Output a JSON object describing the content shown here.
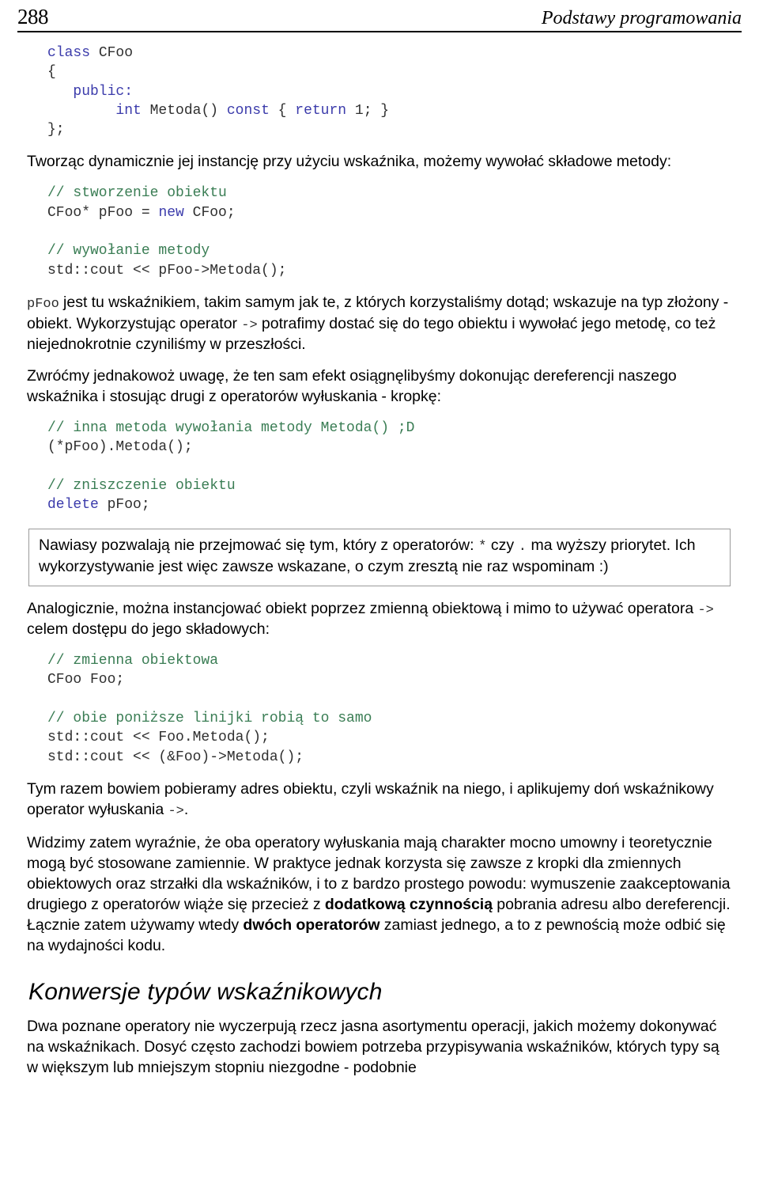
{
  "header": {
    "page_number": "288",
    "title": "Podstawy programowania"
  },
  "code_blocks": {
    "class_decl": [
      [
        {
          "t": "class",
          "c": "kw"
        },
        {
          "t": " CFoo",
          "c": "id"
        }
      ],
      [
        {
          "t": "{",
          "c": "id"
        }
      ],
      [
        {
          "t": "   ",
          "c": "id"
        },
        {
          "t": "public:",
          "c": "kw"
        }
      ],
      [
        {
          "t": "        ",
          "c": "id"
        },
        {
          "t": "int",
          "c": "kw"
        },
        {
          "t": " Metoda() ",
          "c": "id"
        },
        {
          "t": "const",
          "c": "kw"
        },
        {
          "t": " { ",
          "c": "id"
        },
        {
          "t": "return",
          "c": "kw"
        },
        {
          "t": " 1; }",
          "c": "id"
        }
      ],
      [
        {
          "t": "};",
          "c": "id"
        }
      ]
    ],
    "create_and_call": [
      [
        {
          "t": "// stworzenie obiektu",
          "c": "cm"
        }
      ],
      [
        {
          "t": "CFoo* pFoo = ",
          "c": "id"
        },
        {
          "t": "new",
          "c": "kw"
        },
        {
          "t": " CFoo;",
          "c": "id"
        }
      ],
      [
        {
          "t": "",
          "c": "id"
        }
      ],
      [
        {
          "t": "// wywołanie metody",
          "c": "cm"
        }
      ],
      [
        {
          "t": "std::cout << pFoo->Metoda();",
          "c": "id"
        }
      ]
    ],
    "deref_and_delete": [
      [
        {
          "t": "// inna metoda wywołania metody Metoda() ;D",
          "c": "cm"
        }
      ],
      [
        {
          "t": "(*pFoo).Metoda();",
          "c": "id"
        }
      ],
      [
        {
          "t": "",
          "c": "id"
        }
      ],
      [
        {
          "t": "// zniszczenie obiektu",
          "c": "cm"
        }
      ],
      [
        {
          "t": "delete",
          "c": "kw"
        },
        {
          "t": " pFoo;",
          "c": "id"
        }
      ]
    ],
    "object_variable": [
      [
        {
          "t": "// zmienna obiektowa",
          "c": "cm"
        }
      ],
      [
        {
          "t": "CFoo Foo;",
          "c": "id"
        }
      ],
      [
        {
          "t": "",
          "c": "id"
        }
      ],
      [
        {
          "t": "// obie poniższe linijki robią to samo",
          "c": "cm"
        }
      ],
      [
        {
          "t": "std::cout << Foo.Metoda();",
          "c": "id"
        }
      ],
      [
        {
          "t": "std::cout << (&Foo)->Metoda();",
          "c": "id"
        }
      ]
    ]
  },
  "paragraphs": {
    "after_class": "Tworząc dynamicznie jej instancję przy użyciu wskaźnika, możemy wywołać składowe metody:",
    "pfoo_explain_pre": "pFoo",
    "pfoo_explain_mid": " jest tu wskaźnikiem, takim samym jak te, z których korzystaliśmy dotąd; wskazuje na typ złożony - obiekt. Wykorzystując operator ",
    "pfoo_explain_arrow": "->",
    "pfoo_explain_post": " potrafimy dostać się do tego obiektu i wywołać jego metodę, co też niejednokrotnie czyniliśmy w przeszłości.",
    "dereference_note": "Zwróćmy jednakowoż uwagę, że ten sam efekt osiągnęlibyśmy dokonując dereferencji naszego wskaźnika i stosując drugi z operatorów wyłuskania - kropkę:",
    "analogicznie_pre": "Analogicznie, można instancjować obiekt poprzez zmienną obiektową i mimo to używać operatora ",
    "analogicznie_arrow": "->",
    "analogicznie_post": " celem dostępu do jego składowych:",
    "tym_razem_pre": "Tym razem bowiem pobieramy adres obiektu, czyli wskaźnik na niego, i aplikujemy doń wskaźnikowy operator wyłuskania ",
    "tym_razem_arrow": "->",
    "tym_razem_post": ".",
    "widzimy_1": "Widzimy zatem wyraźnie, że oba operatory wyłuskania mają charakter mocno umowny i teoretycznie mogą być stosowane zamiennie. W praktyce jednak korzysta się zawsze z kropki dla zmiennych obiektowych oraz strzałki dla wskaźników, i to z bardzo prostego powodu: wymuszenie zaakceptowania drugiego z operatorów wiąże się przecież z ",
    "widzimy_bold_1": "dodatkową czynnością",
    "widzimy_2": " pobrania adresu albo dereferencji. Łącznie zatem używamy wtedy ",
    "widzimy_bold_2": "dwóch operatorów",
    "widzimy_3": " zamiast jednego, a to z pewnością może odbić się na wydajności kodu."
  },
  "callout": {
    "text_pre": "Nawiasy pozwalają nie przejmować się tym, który z operatorów: ",
    "op_star": "*",
    "text_mid": " czy ",
    "op_dot": ".",
    "text_post": " ma wyższy priorytet. Ich wykorzystywanie jest więc zawsze wskazane, o czym zresztą nie raz wspominam :)"
  },
  "section": {
    "heading": "Konwersje typów wskaźnikowych",
    "intro": "Dwa poznane operatory nie wyczerpują rzecz jasna asortymentu operacji, jakich możemy dokonywać na wskaźnikach. Dosyć często zachodzi bowiem potrzeba przypisywania wskaźników, których typy są w większym lub mniejszym stopniu niezgodne - podobnie"
  },
  "colors": {
    "keyword": "#3b3bab",
    "comment": "#3a7d54",
    "code_text": "#2f2f2f",
    "body_text": "#000000",
    "rule": "#000000",
    "callout_border": "#9a9a9a"
  }
}
